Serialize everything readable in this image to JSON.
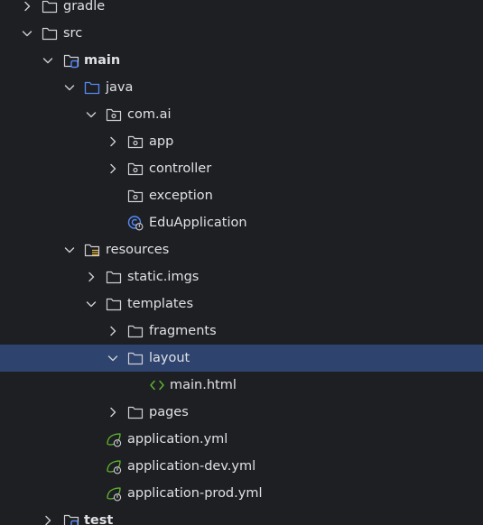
{
  "tree": {
    "gradle": "gradle",
    "src": "src",
    "main": "main",
    "java": "java",
    "com_ai": "com.ai",
    "app": "app",
    "controller": "controller",
    "exception": "exception",
    "edu_application": "EduApplication",
    "resources": "resources",
    "static_imgs": "static.imgs",
    "templates": "templates",
    "fragments": "fragments",
    "layout": "layout",
    "main_html": "main.html",
    "pages": "pages",
    "application_yml": "application.yml",
    "application_dev_yml": "application-dev.yml",
    "application_prod_yml": "application-prod.yml",
    "test": "test"
  },
  "icons": {
    "chevron_right": "chevron-right-icon",
    "chevron_down": "chevron-down-icon",
    "folder": "folder-icon",
    "source_root": "source-folder-icon",
    "resources_root": "resources-folder-icon",
    "package": "package-icon",
    "spring_boot_class": "spring-boot-class-icon",
    "html_file": "html-file-icon",
    "spring_config": "spring-config-icon"
  },
  "colors": {
    "background": "#1e1f22",
    "selection": "#2e436e",
    "text": "#dfe1e5",
    "icon": "#ced0d6",
    "source_blue": "#548af7",
    "spring_green": "#5fb832"
  }
}
